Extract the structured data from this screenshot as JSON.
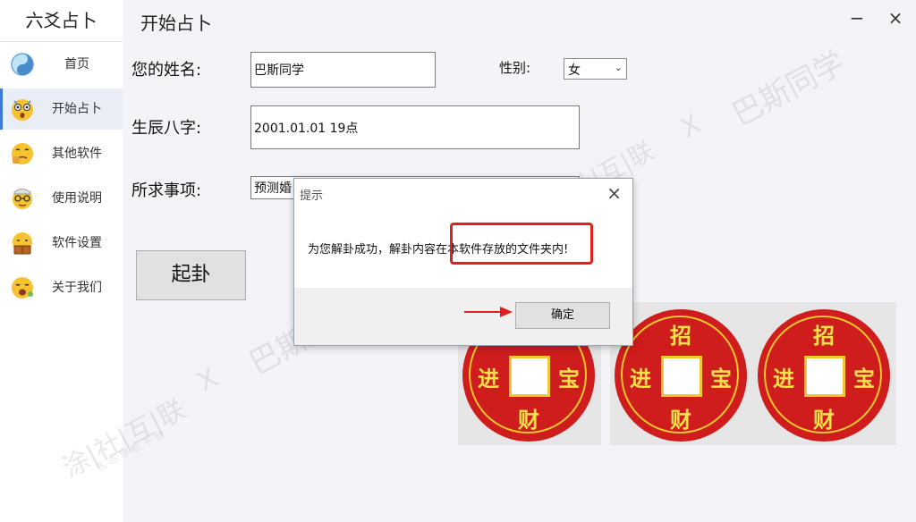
{
  "app": {
    "title": "六爻占卜",
    "page_title": "开始占卜"
  },
  "window": {
    "minimize": "−",
    "close": "×"
  },
  "sidebar": {
    "items": [
      {
        "label": "首页",
        "icon": "yin-yang-icon",
        "active": false
      },
      {
        "label": "开始占卜",
        "icon": "surprised-emoji-icon",
        "active": true
      },
      {
        "label": "其他软件",
        "icon": "thinking-emoji-icon",
        "active": false
      },
      {
        "label": "使用说明",
        "icon": "glasses-emoji-icon",
        "active": false
      },
      {
        "label": "软件设置",
        "icon": "reading-emoji-icon",
        "active": false
      },
      {
        "label": "关于我们",
        "icon": "yawning-emoji-icon",
        "active": false
      }
    ]
  },
  "form": {
    "name_label": "您的姓名:",
    "name_value": "巴斯同学",
    "gender_label": "性别:",
    "gender_value": "女",
    "bazi_label": "生辰八字:",
    "bazi_value": "2001.01.01 19点",
    "matter_label": "所求事项:",
    "matter_value": "预测婚",
    "qigua_button": "起卦"
  },
  "coins": [
    {
      "top": "",
      "left": "进",
      "right": "宝",
      "bottom": "财"
    },
    {
      "top": "招",
      "left": "进",
      "right": "宝",
      "bottom": "财"
    },
    {
      "top": "招",
      "left": "进",
      "right": "宝",
      "bottom": "财"
    }
  ],
  "dialog": {
    "title": "提示",
    "close": "×",
    "message": "为您解卦成功，解卦内容在本软件存放的文件夹内!",
    "ok_button": "确定"
  },
  "watermarks": {
    "text": "巴斯同学",
    "x_mark": "X",
    "brand": "涂|社|互|联",
    "brand_sub": "生 态 导 航 平 台"
  },
  "colors": {
    "accent": "#3c78d8",
    "coin_red": "#cf1d1d",
    "coin_gold": "#f3c82c",
    "annotation_red": "#e02020"
  }
}
